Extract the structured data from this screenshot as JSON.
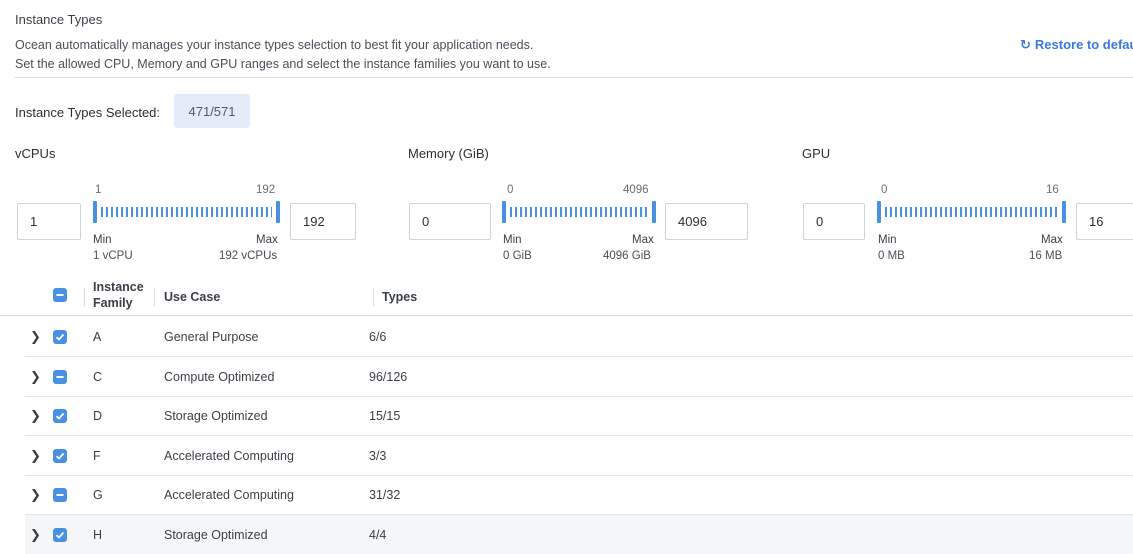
{
  "header": {
    "title": "Instance Types",
    "description_line1": "Ocean automatically manages your instance types selection to best fit your application needs.",
    "description_line2": "Set the allowed CPU, Memory and GPU ranges and select the instance families you want to use.",
    "restore_label": "Restore to defau",
    "restore_icon": "refresh-icon"
  },
  "selection": {
    "label": "Instance Types Selected:",
    "value": "471/571"
  },
  "colors": {
    "accent": "#4a90e2",
    "link": "#3b78e7",
    "badge_bg": "#e3ecf8"
  },
  "ranges": {
    "vcpu": {
      "title": "vCPUs",
      "min_value": "1",
      "max_value": "192",
      "range_min": "1",
      "range_max": "192",
      "min_label": "Min",
      "max_label": "Max",
      "min_unit": "1 vCPU",
      "max_unit": "192 vCPUs"
    },
    "memory": {
      "title": "Memory (GiB)",
      "min_value": "0",
      "max_value": "4096",
      "range_min": "0",
      "range_max": "4096",
      "min_label": "Min",
      "max_label": "Max",
      "min_unit": "0 GiB",
      "max_unit": "4096 GiB"
    },
    "gpu": {
      "title": "GPU",
      "min_value": "0",
      "max_value": "16",
      "range_min": "0",
      "range_max": "16",
      "min_label": "Min",
      "max_label": "Max",
      "min_unit": "0 MB",
      "max_unit": "16 MB"
    }
  },
  "table": {
    "header_checkbox_state": "indeterminate",
    "columns": {
      "family_line1": "Instance",
      "family_line2": "Family",
      "use_case": "Use Case",
      "types": "Types"
    },
    "rows": [
      {
        "family": "A",
        "use_case": "General Purpose",
        "types": "6/6",
        "state": "checked"
      },
      {
        "family": "C",
        "use_case": "Compute Optimized",
        "types": "96/126",
        "state": "indeterminate"
      },
      {
        "family": "D",
        "use_case": "Storage Optimized",
        "types": "15/15",
        "state": "checked"
      },
      {
        "family": "F",
        "use_case": "Accelerated Computing",
        "types": "3/3",
        "state": "checked"
      },
      {
        "family": "G",
        "use_case": "Accelerated Computing",
        "types": "31/32",
        "state": "indeterminate"
      },
      {
        "family": "H",
        "use_case": "Storage Optimized",
        "types": "4/4",
        "state": "checked"
      }
    ]
  }
}
